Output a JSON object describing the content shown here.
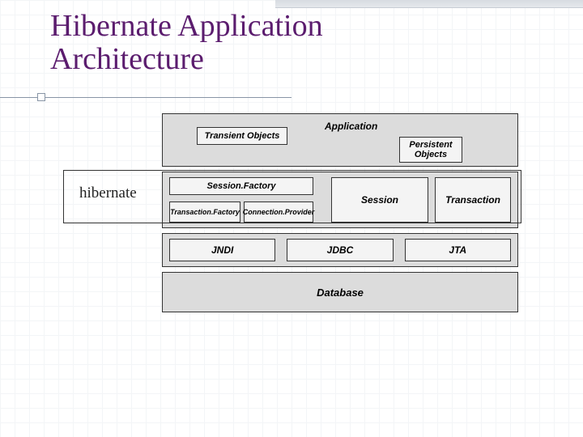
{
  "title_line1": "Hibernate Application",
  "title_line2": "Architecture",
  "hibernate_label": "hibernate",
  "app": {
    "label": "Application",
    "transient": "Transient Objects",
    "persistent": "Persistent Objects"
  },
  "mid": {
    "session_factory": "Session.Factory",
    "transaction_factory": "Transaction.Factory",
    "connection_provider": "Connection.Provider",
    "session": "Session",
    "transaction": "Transaction"
  },
  "api": {
    "jndi": "JNDI",
    "jdbc": "JDBC",
    "jta": "JTA"
  },
  "database": "Database"
}
